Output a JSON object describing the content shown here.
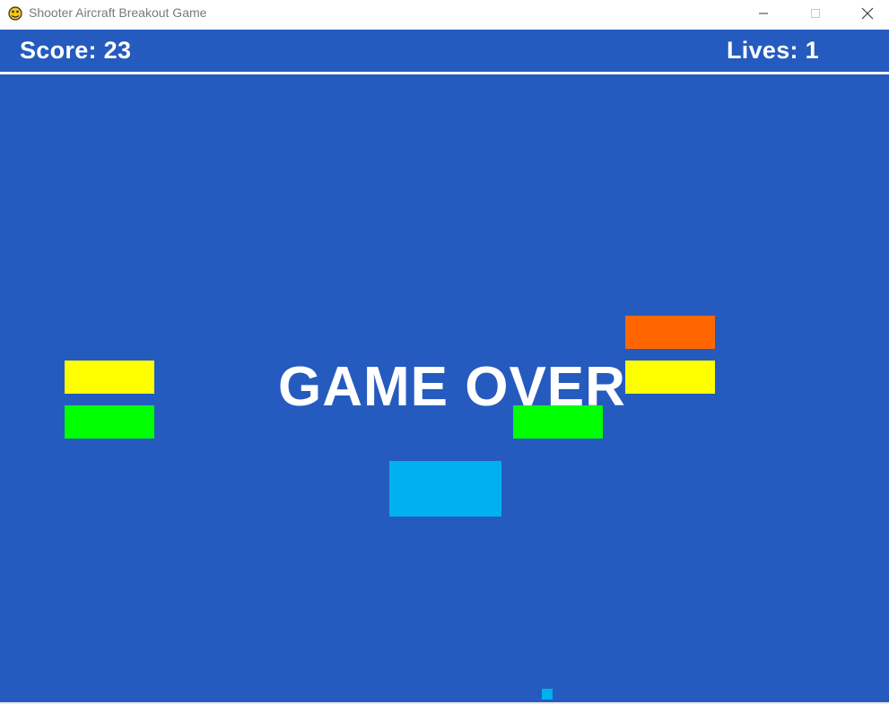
{
  "window": {
    "title": "Shooter Aircraft Breakout Game",
    "icon": "pygame-snake-icon",
    "controls": {
      "minimize": "minimize-icon",
      "maximize": "maximize-icon",
      "close": "close-icon"
    }
  },
  "hud": {
    "score_text": "Score: 23",
    "lives_text": "Lives: 1"
  },
  "game": {
    "status_text": "GAME OVER",
    "colors": {
      "background": "#255bbe",
      "hud_line": "#ffffff",
      "paddle": "#00b0f0",
      "ball": "#00b0f0",
      "brick_yellow": "#ffff00",
      "brick_green": "#00ff00",
      "brick_orange": "#ff6600"
    },
    "bricks": [
      {
        "color": "yellow"
      },
      {
        "color": "green"
      },
      {
        "color": "orange"
      },
      {
        "color": "yellow"
      },
      {
        "color": "green"
      }
    ]
  }
}
